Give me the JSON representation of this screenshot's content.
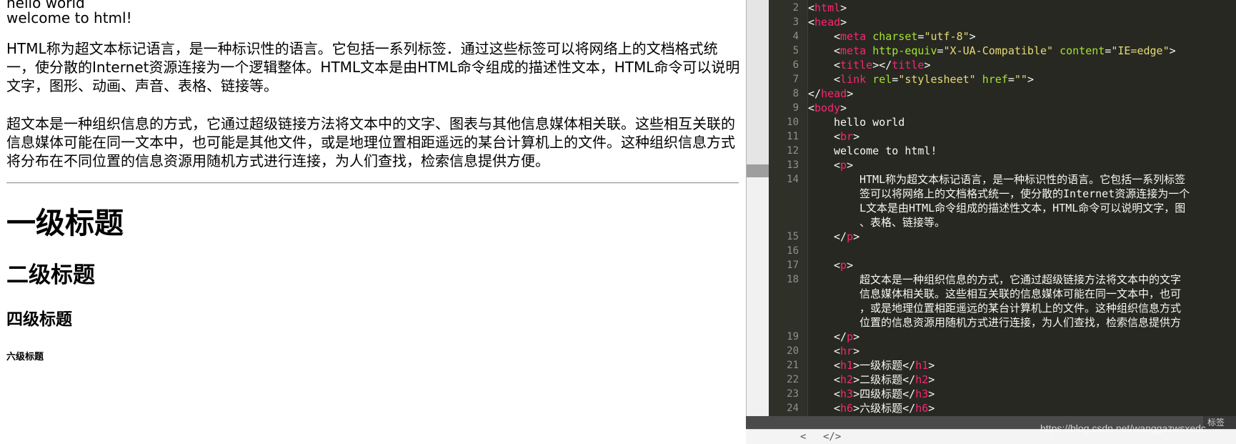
{
  "preview": {
    "line1": "hello world",
    "line2": "welcome to html!",
    "para1": "HTML称为超文本标记语言，是一种标识性的语言。它包括一系列标签．通过这些标签可以将网络上的文档格式统一，使分散的Internet资源连接为一个逻辑整体。HTML文本是由HTML命令组成的描述性文本，HTML命令可以说明文字，图形、动画、声音、表格、链接等。",
    "para2": "超文本是一种组织信息的方式，它通过超级链接方法将文本中的文字、图表与其他信息媒体相关联。这些相互关联的信息媒体可能在同一文本中，也可能是其他文件，或是地理位置相距遥远的某台计算机上的文件。这种组织信息方式将分布在不同位置的信息资源用随机方式进行连接，为人们查找，检索信息提供方便。",
    "h1": "一级标题",
    "h2": "二级标题",
    "h3": "四级标题",
    "h6": "六级标题"
  },
  "editor": {
    "line_numbers": [
      "2",
      "3",
      "4",
      "5",
      "6",
      "7",
      "8",
      "9",
      "10",
      "11",
      "12",
      "13",
      "14",
      "15",
      "16",
      "17",
      "18",
      "19",
      "20",
      "21",
      "22",
      "23",
      "24"
    ],
    "tags": {
      "html": "html",
      "head": "head",
      "meta": "meta",
      "title": "title",
      "link": "link",
      "body": "body",
      "br": "br",
      "p": "p",
      "hr": "hr",
      "h1": "h1",
      "h2": "h2",
      "h3": "h3",
      "h6": "h6"
    },
    "attrs": {
      "charset": "charset",
      "http_equiv": "http-equiv",
      "content": "content",
      "rel": "rel",
      "href": "href"
    },
    "strings": {
      "utf8": "\"utf-8\"",
      "x_ua": "\"X-UA-Compatible\"",
      "ie_edge": "\"IE=edge\"",
      "stylesheet": "\"stylesheet\"",
      "empty": "\"\""
    },
    "text": {
      "hello": "hello world",
      "welcome": "welcome to html!",
      "p1_l1": "HTML称为超文本标记语言，是一种标识性的语言。它包括一系列标签",
      "p1_l2": "签可以将网络上的文档格式统一，使分散的Internet资源连接为一个",
      "p1_l3": "L文本是由HTML命令组成的描述性文本，HTML命令可以说明文字，图",
      "p1_l4": "、表格、链接等。",
      "p2_l1": "超文本是一种组织信息的方式，它通过超级链接方法将文本中的文字",
      "p2_l2": "信息媒体相关联。这些相互关联的信息媒体可能在同一文本中，也可",
      "p2_l3": "，或是地理位置相距遥远的某台计算机上的文件。这种组织信息方式",
      "p2_l4": "位置的信息资源用随机方式进行连接，为人们查找，检索信息提供方",
      "h1": "一级标题",
      "h2": "二级标题",
      "h3": "四级标题",
      "h6": "六级标题"
    }
  },
  "statusbar": {
    "right_label": "标签"
  },
  "navbar": {
    "back_label": "<",
    "code_view_label": "</>"
  },
  "watermark": "https://blog.csdn.net/wanggazwsxedc",
  "colors": {
    "editor_bg": "#272822",
    "tag": "#f92672",
    "attr": "#a6e22e",
    "string": "#e6db74",
    "text": "#f8f8f2"
  }
}
